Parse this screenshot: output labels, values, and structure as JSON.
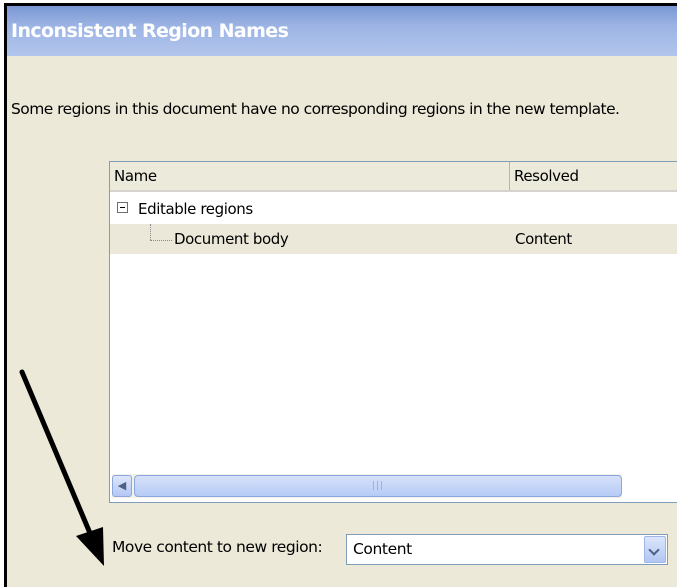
{
  "dialog": {
    "title": "Inconsistent Region Names",
    "message": "Some regions in this document have no corresponding regions in the new template."
  },
  "tree": {
    "columns": {
      "name": "Name",
      "resolved": "Resolved"
    },
    "group": {
      "label": "Editable regions",
      "expanded": true
    },
    "items": [
      {
        "name": "Document body",
        "resolved": "Content"
      }
    ]
  },
  "move_content": {
    "label": "Move content to new region:",
    "selected": "Content"
  },
  "icons": {
    "expander": "minus-box-icon",
    "scroll_left": "scroll-left-arrow-icon",
    "dropdown": "chevron-down-icon",
    "annotation": "arrow-annotation"
  }
}
